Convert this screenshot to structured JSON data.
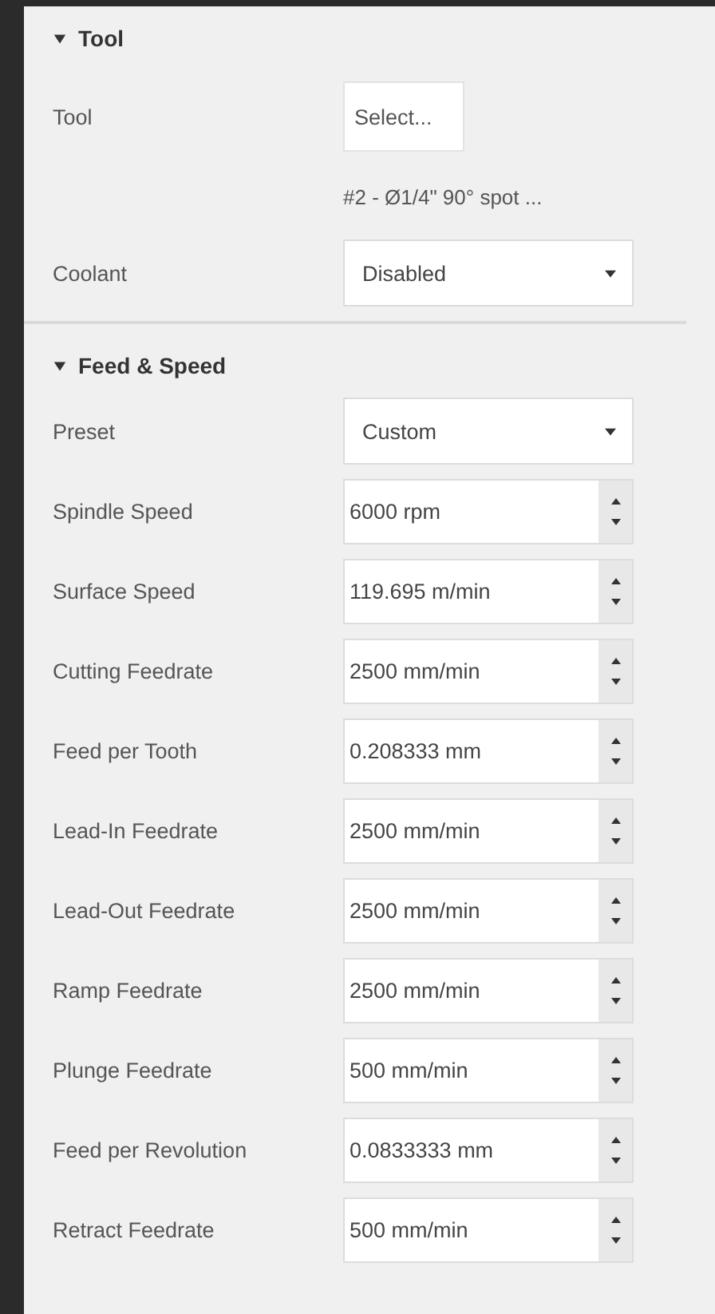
{
  "sections": [
    {
      "title": "Tool",
      "expanded": true,
      "rows": [
        {
          "kind": "button",
          "label": "Tool",
          "value": "Select..."
        },
        {
          "kind": "note",
          "value": "#2 - Ø1/4\" 90° spot ..."
        },
        {
          "kind": "dropdown",
          "label": "Coolant",
          "value": "Disabled"
        }
      ]
    },
    {
      "title": "Feed & Speed",
      "expanded": true,
      "rows": [
        {
          "kind": "dropdown",
          "label": "Preset",
          "value": "Custom"
        },
        {
          "kind": "spinner",
          "label": "Spindle Speed",
          "value": "6000 rpm"
        },
        {
          "kind": "spinner",
          "label": "Surface Speed",
          "value": "119.695 m/min"
        },
        {
          "kind": "spinner",
          "label": "Cutting Feedrate",
          "value": "2500 mm/min"
        },
        {
          "kind": "spinner",
          "label": "Feed per Tooth",
          "value": "0.208333 mm"
        },
        {
          "kind": "spinner",
          "label": "Lead-In Feedrate",
          "value": "2500 mm/min"
        },
        {
          "kind": "spinner",
          "label": "Lead-Out Feedrate",
          "value": "2500 mm/min"
        },
        {
          "kind": "spinner",
          "label": "Ramp Feedrate",
          "value": "2500 mm/min"
        },
        {
          "kind": "spinner",
          "label": "Plunge Feedrate",
          "value": "500 mm/min"
        },
        {
          "kind": "spinner",
          "label": "Feed per Revolution",
          "value": "0.0833333 mm"
        },
        {
          "kind": "spinner",
          "label": "Retract Feedrate",
          "value": "500 mm/min"
        }
      ]
    }
  ]
}
